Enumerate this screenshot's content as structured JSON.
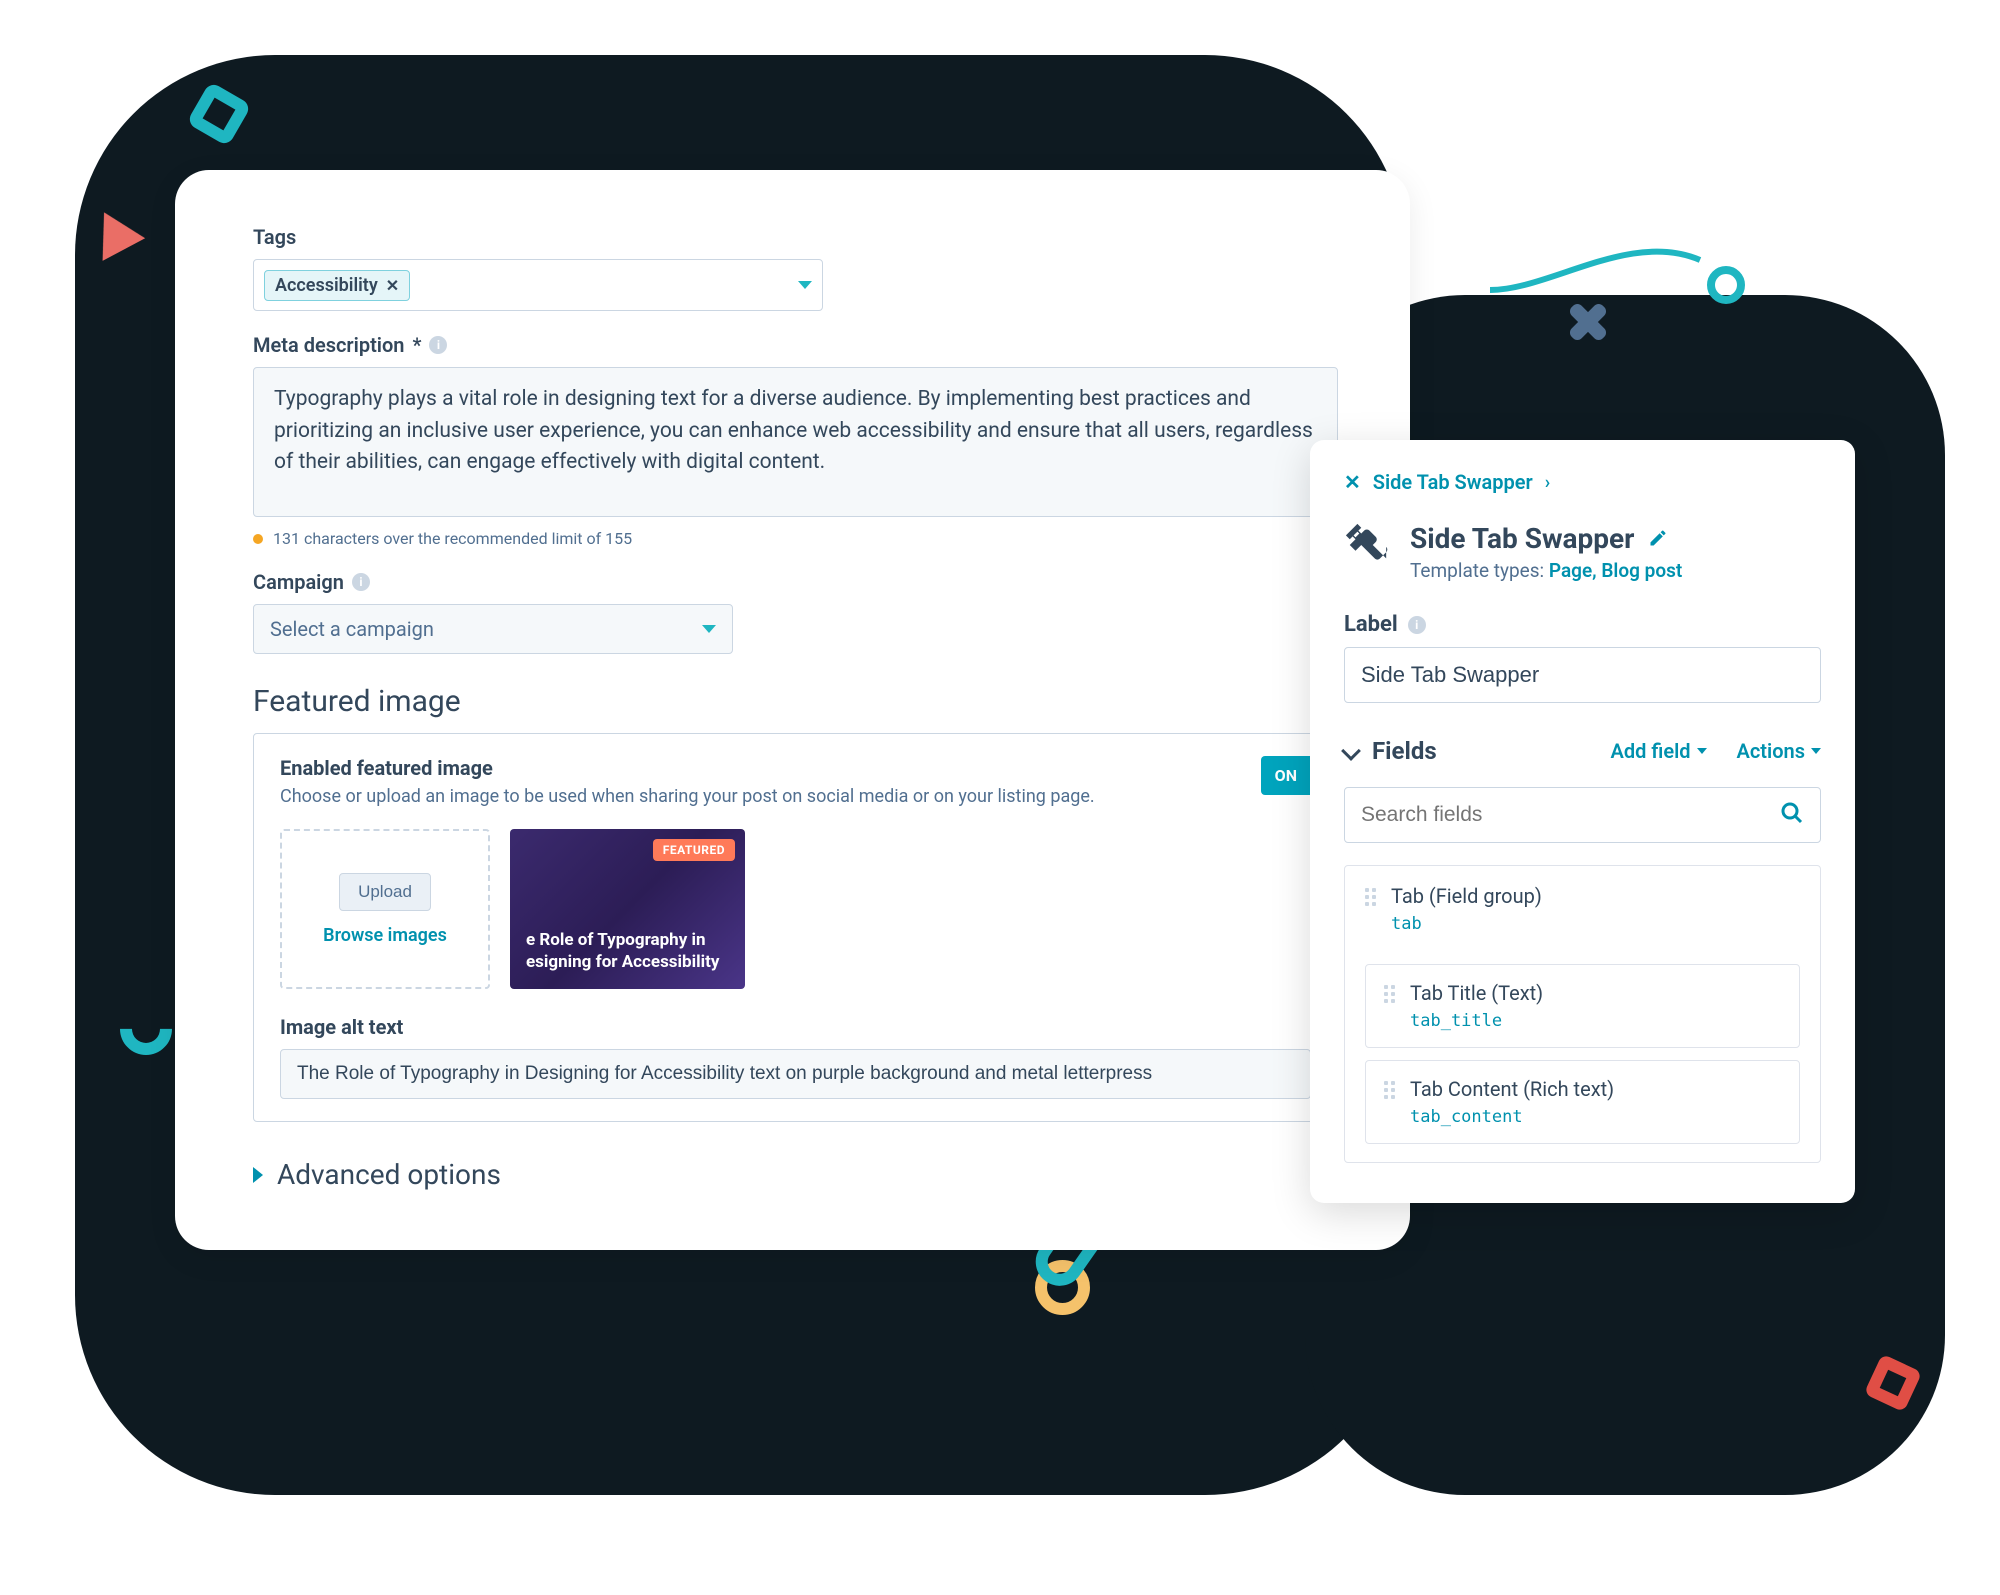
{
  "settings": {
    "tags": {
      "label": "Tags",
      "chip": "Accessibility"
    },
    "meta": {
      "label": "Meta description",
      "required_mark": "*",
      "value": "Typography plays a vital role in designing text for a diverse audience. By implementing best practices and prioritizing an inclusive user experience, you can enhance web accessibility and ensure that all users, regardless of their abilities, can engage effectively with digital content.",
      "warning": "131 characters over the recommended limit of 155"
    },
    "campaign": {
      "label": "Campaign",
      "placeholder": "Select a campaign"
    },
    "featured": {
      "section_title": "Featured image",
      "enabled_heading": "Enabled featured image",
      "enabled_sub": "Choose or upload an image to be used when sharing your post on social media or on your listing page.",
      "toggle_label": "ON",
      "upload_button": "Upload",
      "browse_link": "Browse images",
      "thumb_badge": "FEATURED",
      "thumb_line1": "e Role of Typography in",
      "thumb_line2": "esigning for Accessibility",
      "alt_label": "Image alt text",
      "alt_value": "The Role of Typography in Designing for Accessibility text on purple background and metal letterpress"
    },
    "advanced_label": "Advanced options"
  },
  "side": {
    "crumb": "Side Tab Swapper",
    "title": "Side Tab Swapper",
    "template_prefix": "Template types: ",
    "template_types": "Page, Blog post",
    "label_heading": "Label",
    "label_value": "Side Tab Swapper",
    "fields_heading": "Fields",
    "add_field": "Add field",
    "actions": "Actions",
    "search_placeholder": "Search fields",
    "group": {
      "title": "Tab (Field group)",
      "code": "tab"
    },
    "subfields": [
      {
        "title": "Tab Title (Text)",
        "code": "tab_title"
      },
      {
        "title": "Tab Content (Rich text)",
        "code": "tab_content"
      }
    ]
  }
}
